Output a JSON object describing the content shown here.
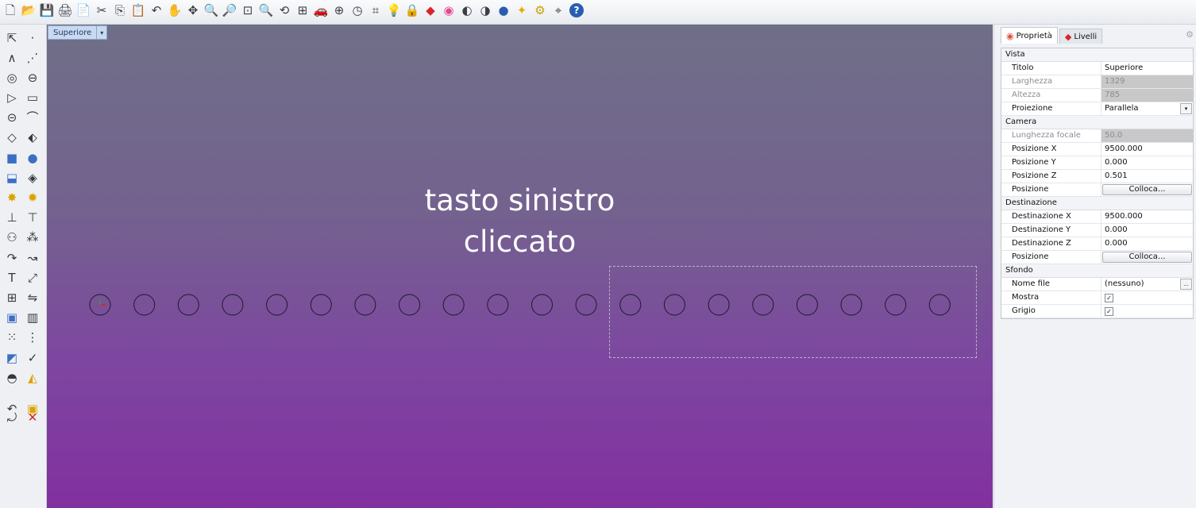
{
  "toolbar": {
    "icons": [
      {
        "name": "new-file-icon",
        "glyph": "🗋"
      },
      {
        "name": "open-folder-icon",
        "glyph": "📂"
      },
      {
        "name": "save-icon",
        "glyph": "💾"
      },
      {
        "name": "print-icon",
        "glyph": "🖨"
      },
      {
        "name": "export-icon",
        "glyph": "📄"
      },
      {
        "name": "cut-icon",
        "glyph": "✂"
      },
      {
        "name": "copy-icon",
        "glyph": "⎘"
      },
      {
        "name": "paste-icon",
        "glyph": "📋"
      },
      {
        "name": "undo-icon",
        "glyph": "↶"
      },
      {
        "name": "pan-hand-icon",
        "glyph": "✋"
      },
      {
        "name": "rotate-view-icon",
        "glyph": "✥"
      },
      {
        "name": "zoom-icon",
        "glyph": "🔍"
      },
      {
        "name": "zoom-window-icon",
        "glyph": "🔎"
      },
      {
        "name": "zoom-extents-icon",
        "glyph": "⊡"
      },
      {
        "name": "zoom-selected-icon",
        "glyph": "🔍"
      },
      {
        "name": "undo-view-icon",
        "glyph": "⟲"
      },
      {
        "name": "four-viewports-icon",
        "glyph": "⊞"
      },
      {
        "name": "car-icon",
        "glyph": "🚗"
      },
      {
        "name": "snapshot-icon",
        "glyph": "⊕"
      },
      {
        "name": "clock-icon",
        "glyph": "◷"
      },
      {
        "name": "named-view-icon",
        "glyph": "⌗"
      },
      {
        "name": "lightbulb-icon",
        "glyph": "💡"
      },
      {
        "name": "lock-icon",
        "glyph": "🔒"
      },
      {
        "name": "layer-icon",
        "glyph": "◆"
      },
      {
        "name": "color-wheel-icon",
        "glyph": "◉"
      },
      {
        "name": "shaded-sphere-icon",
        "glyph": "◐"
      },
      {
        "name": "render-sphere-icon",
        "glyph": "◑"
      },
      {
        "name": "blue-sphere-icon",
        "glyph": "●"
      },
      {
        "name": "wand-icon",
        "glyph": "✦"
      },
      {
        "name": "options-gear-icon",
        "glyph": "⚙"
      },
      {
        "name": "snap-grid-icon",
        "glyph": "⌖"
      },
      {
        "name": "help-icon",
        "glyph": "?"
      }
    ],
    "colors": {
      "layer": "#d9252a",
      "colorWheel": "#e04a8f",
      "blueSphere": "#2a5db0",
      "help": "#2a5db0",
      "wand": "#e0b000"
    }
  },
  "sidebar": {
    "icons": [
      {
        "name": "select-arrow-icon",
        "glyph": "⇱"
      },
      {
        "name": "point-icon",
        "glyph": "·"
      },
      {
        "name": "polyline-icon",
        "glyph": "∧"
      },
      {
        "name": "line-segments-icon",
        "glyph": "⋰"
      },
      {
        "name": "circle-icon",
        "glyph": "◎"
      },
      {
        "name": "ellipse-icon",
        "glyph": "⊖"
      },
      {
        "name": "polygon-icon",
        "glyph": "▷"
      },
      {
        "name": "rectangle-icon",
        "glyph": "▭"
      },
      {
        "name": "arc-icon",
        "glyph": "⊝"
      },
      {
        "name": "curve-icon",
        "glyph": "⌒"
      },
      {
        "name": "surface-icon",
        "glyph": "◇"
      },
      {
        "name": "surface-sweep-icon",
        "glyph": "⬖"
      },
      {
        "name": "box-solid-icon",
        "glyph": "■"
      },
      {
        "name": "sphere-solid-icon",
        "glyph": "●"
      },
      {
        "name": "extrude-icon",
        "glyph": "⬓"
      },
      {
        "name": "patch-icon",
        "glyph": "◈"
      },
      {
        "name": "explode-icon",
        "glyph": "✸"
      },
      {
        "name": "boolean-icon",
        "glyph": "✹"
      },
      {
        "name": "dimension-icon",
        "glyph": "⊥"
      },
      {
        "name": "align-icon",
        "glyph": "⊤"
      },
      {
        "name": "group-icon",
        "glyph": "⚇"
      },
      {
        "name": "points-icon",
        "glyph": "⁂"
      },
      {
        "name": "fillet-curve-icon",
        "glyph": "↷"
      },
      {
        "name": "offset-curve-icon",
        "glyph": "↝"
      },
      {
        "name": "text-icon",
        "glyph": "T"
      },
      {
        "name": "transform-icon",
        "glyph": "⤢"
      },
      {
        "name": "array-icon",
        "glyph": "⊞"
      },
      {
        "name": "mirror-icon",
        "glyph": "⇋"
      },
      {
        "name": "block-icon",
        "glyph": "▣"
      },
      {
        "name": "hatch-icon",
        "glyph": "▥"
      },
      {
        "name": "grid-array-icon",
        "glyph": "⁙"
      },
      {
        "name": "analyze-icon",
        "glyph": "⋮"
      },
      {
        "name": "render-icon",
        "glyph": "◩"
      },
      {
        "name": "check-icon",
        "glyph": "✓"
      },
      {
        "name": "shade-icon",
        "glyph": "◓"
      },
      {
        "name": "paint-bucket-icon",
        "glyph": "◭"
      },
      {
        "name": "undo-alt-icon",
        "glyph": "↶"
      },
      {
        "name": "cube-yellow-icon",
        "glyph": "▣"
      },
      {
        "name": "redo-alt-icon",
        "glyph": "⤾"
      },
      {
        "name": "cancel-icon",
        "glyph": "✕"
      }
    ]
  },
  "viewport": {
    "tab_label": "Superiore",
    "tab_arrow": "▾",
    "overlay_line1": "tasto sinistro",
    "overlay_line2": "cliccato",
    "circle_count": 20,
    "circle_color": "#1b1b2a",
    "background_top": "#6f6f88",
    "background_bottom": "#82309f"
  },
  "panel": {
    "tab_properties": "Proprietà",
    "tab_layers": "Livelli",
    "sections": {
      "vista": "Vista",
      "camera": "Camera",
      "destinazione": "Destinazione",
      "sfondo": "Sfondo"
    },
    "rows": {
      "titolo": {
        "label": "Titolo",
        "value": "Superiore"
      },
      "larghezza": {
        "label": "Larghezza",
        "value": "1329"
      },
      "altezza": {
        "label": "Altezza",
        "value": "785"
      },
      "proiezione": {
        "label": "Proiezione",
        "value": "Parallela"
      },
      "lunghezza_focale": {
        "label": "Lunghezza focale",
        "value": "50.0"
      },
      "posizione_x": {
        "label": "Posizione X",
        "value": "9500.000"
      },
      "posizione_y": {
        "label": "Posizione Y",
        "value": "0.000"
      },
      "posizione_z": {
        "label": "Posizione Z",
        "value": "0.501"
      },
      "posizione": {
        "label": "Posizione",
        "button": "Colloca..."
      },
      "destinazione_x": {
        "label": "Destinazione X",
        "value": "9500.000"
      },
      "destinazione_y": {
        "label": "Destinazione Y",
        "value": "0.000"
      },
      "destinazione_z": {
        "label": "Destinazione Z",
        "value": "0.000"
      },
      "dest_posizione": {
        "label": "Posizione",
        "button": "Colloca..."
      },
      "nome_file": {
        "label": "Nome file",
        "value": "(nessuno)",
        "browse": "..."
      },
      "mostra": {
        "label": "Mostra",
        "checked": true,
        "mark": "✓"
      },
      "grigio": {
        "label": "Grigio",
        "checked": true,
        "mark": "✓"
      }
    },
    "dropdown_arrow": "▾"
  }
}
